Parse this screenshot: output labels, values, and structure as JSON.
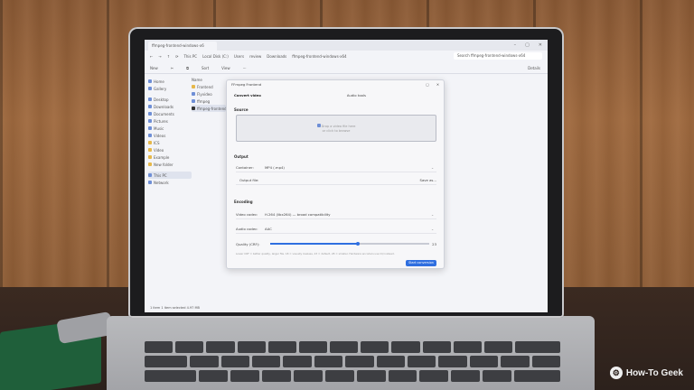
{
  "explorer": {
    "tab_title": "ffmpeg-frontend-windows-x6",
    "breadcrumb": [
      "This PC",
      "Local Disk (C:)",
      "Users",
      "review",
      "Downloads",
      "ffmpeg-frontend-windows-x64"
    ],
    "search_placeholder": "Search ffmpeg-frontend-windows-x64",
    "commands": {
      "new": "New",
      "sort": "Sort",
      "view": "View",
      "more": "···",
      "details": "Details"
    },
    "nav_items": [
      {
        "label": "Home",
        "icon": "home-icon",
        "folder": false
      },
      {
        "label": "Gallery",
        "icon": "gallery-icon",
        "folder": false
      },
      {
        "label": "Desktop",
        "icon": "desktop-icon",
        "folder": false
      },
      {
        "label": "Downloads",
        "icon": "download-icon",
        "folder": false
      },
      {
        "label": "Documents",
        "icon": "document-icon",
        "folder": false
      },
      {
        "label": "Pictures",
        "icon": "pictures-icon",
        "folder": false
      },
      {
        "label": "Music",
        "icon": "music-icon",
        "folder": false
      },
      {
        "label": "Videos",
        "icon": "video-icon",
        "folder": false
      },
      {
        "label": "ICS",
        "icon": "folder-icon",
        "folder": true
      },
      {
        "label": "Video",
        "icon": "folder-icon",
        "folder": true
      },
      {
        "label": "Example",
        "icon": "folder-icon",
        "folder": true
      },
      {
        "label": "New folder",
        "icon": "folder-icon",
        "folder": true
      },
      {
        "label": "This PC",
        "icon": "computer-icon",
        "folder": false,
        "selected": true
      },
      {
        "label": "Network",
        "icon": "network-icon",
        "folder": false
      }
    ],
    "file_header": "Name",
    "files": [
      {
        "label": "Frontend",
        "selected": false
      },
      {
        "label": "Flyvideo",
        "selected": false
      },
      {
        "label": "ffmpeg",
        "selected": false
      },
      {
        "label": "ffmpeg-frontend",
        "selected": true
      }
    ],
    "status": "1 item   1 item selected  4.97 MB"
  },
  "dialog": {
    "title": "FFmpeg Frontend",
    "tabs": [
      "Convert video",
      "Audio tools"
    ],
    "source_heading": "Source",
    "dropzone_line1": "Drop a video file here",
    "dropzone_line2": "or click to browse",
    "output_heading": "Output",
    "container_label": "Container:",
    "container_value": "MP4 (.mp4)",
    "output_file_label": "Output file:",
    "save_as": "Save as...",
    "encoding_heading": "Encoding",
    "video_codec_label": "Video codec:",
    "video_codec_value": "H.264 (libx264) — broad compatibility",
    "audio_codec_label": "Audio codec:",
    "audio_codec_value": "AAC",
    "quality_label": "Quality (CRF):",
    "quality_value": "23",
    "quality_fraction": 0.55,
    "hint": "Lower CRF = better quality, larger file. 18 = visually lossless, 23 = default, 28 = smaller. Hardware encoders use CQ instead.",
    "start_button": "Start conversion"
  },
  "watermark": "How-To Geek"
}
